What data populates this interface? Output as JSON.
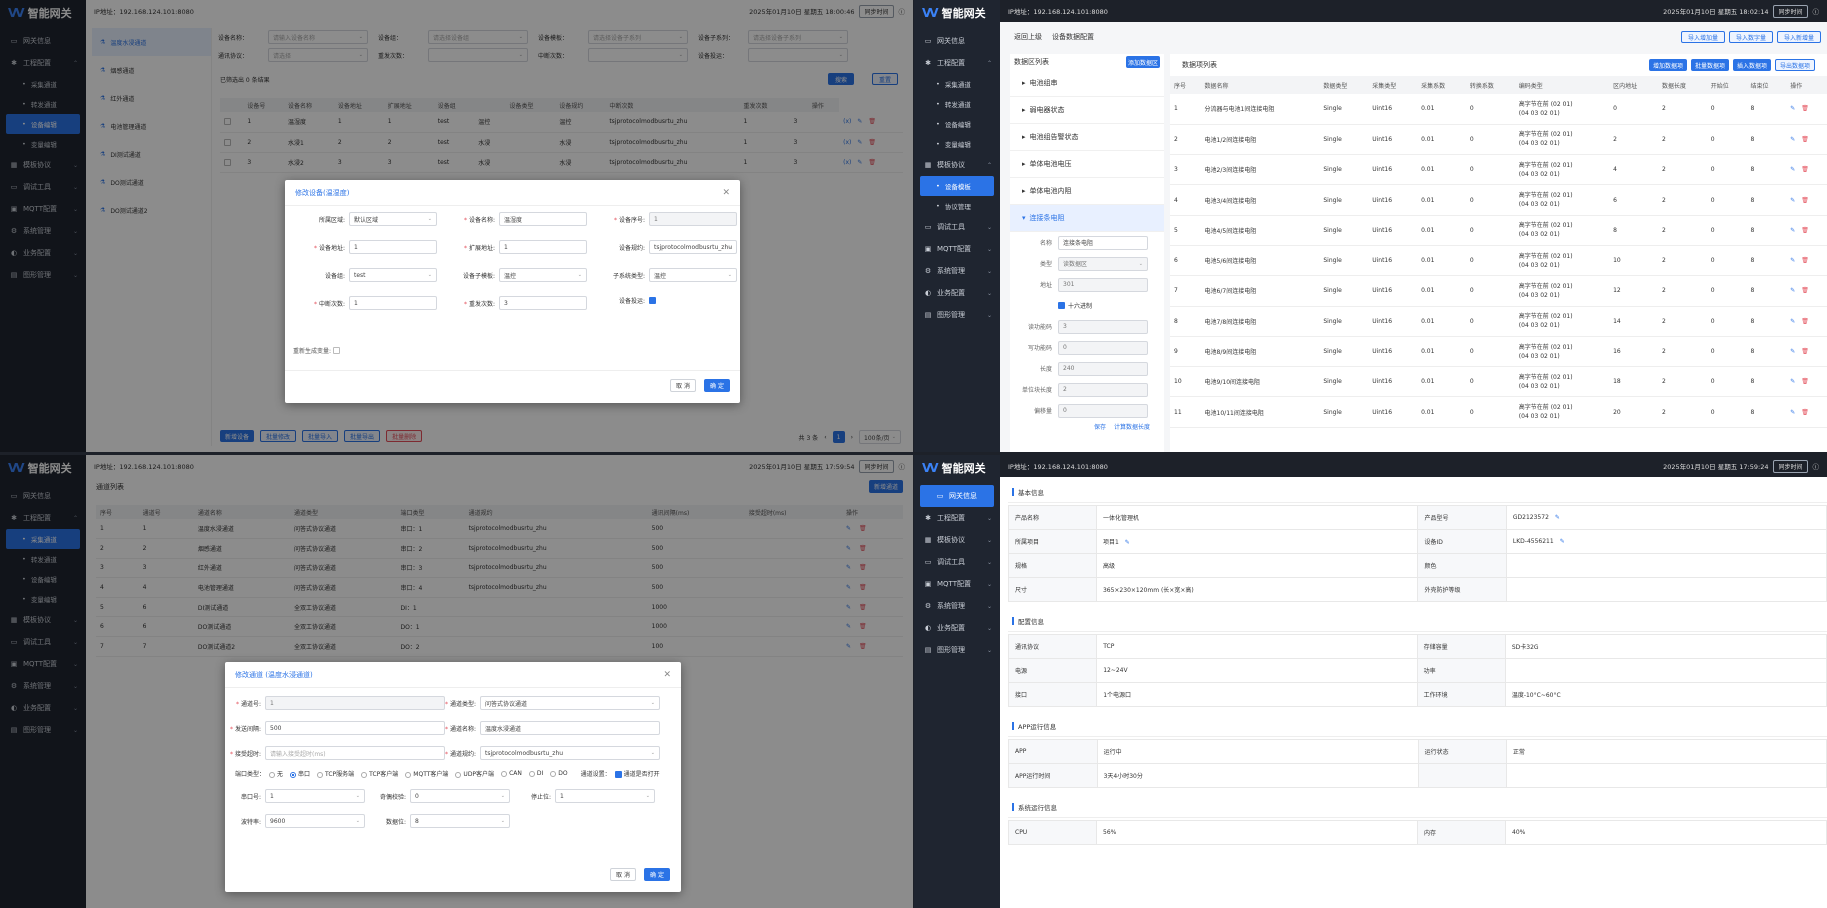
{
  "app": {
    "logo": "智能网关",
    "ip_label": "IP地址：192.168.124.101:8080"
  },
  "icons": {
    "logo": "ww-logo",
    "info": "info-circle-icon",
    "edit": "pencil-icon",
    "delete": "trash-icon",
    "chevron": "chevron-icon"
  },
  "colors": {
    "accent": "#2b73e6",
    "danger": "#e34d59",
    "sidebar": "#1f2530"
  },
  "q1": {
    "datetime": "2025年01月10日 星期五 18:00:46",
    "sync": "同步时间",
    "sidebar": [
      "网关信息",
      "工程配置",
      "采集通道",
      "转发通道",
      "设备编辑",
      "变量编辑",
      "模板协议",
      "调试工具",
      "MQTT配置",
      "系统管理",
      "业务配置",
      "图形管理"
    ],
    "channels": [
      "温度水浸通道",
      "烟感通道",
      "红外通道",
      "电池管理通道",
      "DI测试通道",
      "DO测试通道",
      "DO测试通道2"
    ],
    "filters": [
      "设备名称：",
      "设备组：",
      "设备模板：",
      "设备子系列：",
      "通讯协议：",
      "重发次数：",
      "中断次数：",
      "设备投运："
    ],
    "filter_placeholders": [
      "请输入设备名称",
      "请选择设备组",
      "请选择设备子系列",
      "请选择设备子系列",
      "请选择",
      "",
      "",
      ""
    ],
    "selected": "已筛选出 0 条结果",
    "search": "搜索",
    "reset": "重置",
    "cols": [
      "",
      "设备号",
      "设备名称",
      "设备地址",
      "扩展地址",
      "设备组",
      "",
      "设备类型",
      "设备规约",
      "中断次数",
      "重发次数",
      "",
      "操作"
    ],
    "rows": [
      [
        "1",
        "温湿度",
        "1",
        "1",
        "test",
        "温控",
        "温控",
        "tsjprotocolmodbusrtu_zhu",
        "1",
        "3"
      ],
      [
        "2",
        "水浸1",
        "2",
        "2",
        "test",
        "水浸",
        "水浸",
        "tsjprotocolmodbusrtu_zhu",
        "1",
        "3"
      ],
      [
        "3",
        "水浸2",
        "3",
        "3",
        "test",
        "水浸",
        "水浸",
        "tsjprotocolmodbusrtu_zhu",
        "1",
        "3"
      ]
    ],
    "bottom": [
      "新增设备",
      "批量修改",
      "批量导入",
      "批量导出",
      "批量删除"
    ],
    "pager": {
      "total": "共 3 条",
      "page": "1",
      "size": "100条/页"
    },
    "dialog": {
      "title": "修改设备(温湿度)",
      "fields": [
        {
          "label": "所属区域:",
          "value": "默认区域",
          "dd": true
        },
        {
          "label": "设备名称:",
          "value": "温湿度",
          "req": true
        },
        {
          "label": "设备序号:",
          "value": "1",
          "req": true,
          "ro": true
        },
        {
          "label": "设备地址:",
          "value": "1",
          "req": true
        },
        {
          "label": "扩展地址:",
          "value": "1",
          "req": true
        },
        {
          "label": "设备规约:",
          "value": "tsjprotocolmodbusrtu_zhu",
          "dd": true
        },
        {
          "label": "设备组:",
          "value": "test",
          "dd": true
        },
        {
          "label": "设备子模板:",
          "value": "温控",
          "dd": true
        },
        {
          "label": "子系统类型:",
          "value": "温控",
          "dd": true
        },
        {
          "label": "中断次数:",
          "value": "1",
          "req": true
        },
        {
          "label": "重发次数:",
          "value": "3",
          "req": true
        },
        {
          "label": "设备投运:",
          "value": ""
        }
      ],
      "regen": "重新生成变量:",
      "cancel": "取 消",
      "ok": "确 定"
    }
  },
  "q2": {
    "datetime": "2025年01月10日 星期五 18:02:14",
    "sync": "同步时间",
    "sidebar": [
      "网关信息",
      "工程配置",
      "采集通道",
      "转发通道",
      "设备编辑",
      "变量编辑",
      "模板协议",
      "设备模板",
      "协议管理",
      "调试工具",
      "MQTT配置",
      "系统管理",
      "业务配置",
      "图形管理"
    ],
    "back": "返回上级",
    "crumb": "设备数据配置",
    "top_buttons": [
      "导入增加量",
      "导入数字量",
      "导入新增量"
    ],
    "left_title": "数据区列表",
    "add_area": "添加数据区",
    "areas": [
      "电池组串",
      "弱电器状态",
      "电池组告警状态",
      "单体电池电压",
      "单体电池内阻",
      "连接条电阻"
    ],
    "form": [
      {
        "l": "名称",
        "v": "连接条电阻"
      },
      {
        "l": "类型",
        "v": "读数据区"
      },
      {
        "l": "地址",
        "v": "301"
      },
      {
        "l": "",
        "v": "十六进制"
      },
      {
        "l": "读功能码",
        "v": "3"
      },
      {
        "l": "写功能码",
        "v": "0"
      },
      {
        "l": "长度",
        "v": "240"
      },
      {
        "l": "单位块长度",
        "v": "2"
      },
      {
        "l": "偏移量",
        "v": "0"
      }
    ],
    "save": "保存",
    "calc": "计算数据长度",
    "right_title": "数据项列表",
    "right_buttons": [
      "增加数据项",
      "批量数据项",
      "插入数据项",
      "导出数据项"
    ],
    "cols": [
      "序号",
      "数据名称",
      "数据类型",
      "采集类型",
      "采集系数",
      "转换系数",
      "编码类型",
      "区内地址",
      "数据长度",
      "开始位",
      "结束位",
      "操作"
    ],
    "rows": [
      [
        "1",
        "分流器与电池1间连接电阻",
        "Single",
        "Uint16",
        "0.01",
        "0",
        "0",
        "2",
        "0",
        "8"
      ],
      [
        "2",
        "电池1/2间连接电阻",
        "Single",
        "Uint16",
        "0.01",
        "0",
        "2",
        "2",
        "0",
        "8"
      ],
      [
        "3",
        "电池2/3间连接电阻",
        "Single",
        "Uint16",
        "0.01",
        "0",
        "4",
        "2",
        "0",
        "8"
      ],
      [
        "4",
        "电池3/4间连接电阻",
        "Single",
        "Uint16",
        "0.01",
        "0",
        "6",
        "2",
        "0",
        "8"
      ],
      [
        "5",
        "电池4/5间连接电阻",
        "Single",
        "Uint16",
        "0.01",
        "0",
        "8",
        "2",
        "0",
        "8"
      ],
      [
        "6",
        "电池5/6间连接电阻",
        "Single",
        "Uint16",
        "0.01",
        "0",
        "10",
        "2",
        "0",
        "8"
      ],
      [
        "7",
        "电池6/7间连接电阻",
        "Single",
        "Uint16",
        "0.01",
        "0",
        "12",
        "2",
        "0",
        "8"
      ],
      [
        "8",
        "电池7/8间连接电阻",
        "Single",
        "Uint16",
        "0.01",
        "0",
        "14",
        "2",
        "0",
        "8"
      ],
      [
        "9",
        "电池8/9间连接电阻",
        "Single",
        "Uint16",
        "0.01",
        "0",
        "16",
        "2",
        "0",
        "8"
      ],
      [
        "10",
        "电池9/10间连接电阻",
        "Single",
        "Uint16",
        "0.01",
        "0",
        "18",
        "2",
        "0",
        "8"
      ],
      [
        "11",
        "电池10/11间连接电阻",
        "Single",
        "Uint16",
        "0.01",
        "0",
        "20",
        "2",
        "0",
        "8"
      ]
    ],
    "enc": [
      "高字节在前 (02 01)",
      "(04 03 02 01)"
    ]
  },
  "q3": {
    "datetime": "2025年01月10日 星期五 17:59:54",
    "sync": "同步时间",
    "sidebar": [
      "网关信息",
      "工程配置",
      "采集通道",
      "转发通道",
      "设备编辑",
      "变量编辑",
      "模板协议",
      "调试工具",
      "MQTT配置",
      "系统管理",
      "业务配置",
      "图形管理"
    ],
    "title": "通道列表",
    "new": "新增通道",
    "cols": [
      "序号",
      "通道号",
      "通道名称",
      "通道类型",
      "端口类型",
      "通道规约",
      "通讯间隔(ms)",
      "接受超时(ms)",
      "操作"
    ],
    "rows": [
      [
        "1",
        "1",
        "温度水浸通道",
        "问答式协议通道",
        "串口：1",
        "tsjprotocolmodbusrtu_zhu",
        "500",
        ""
      ],
      [
        "2",
        "2",
        "烟感通道",
        "问答式协议通道",
        "串口：2",
        "tsjprotocolmodbusrtu_zhu",
        "500",
        ""
      ],
      [
        "3",
        "3",
        "红外通道",
        "问答式协议通道",
        "串口：3",
        "tsjprotocolmodbusrtu_zhu",
        "500",
        ""
      ],
      [
        "4",
        "4",
        "电池管理通道",
        "问答式协议通道",
        "串口：4",
        "tsjprotocolmodbusrtu_zhu",
        "500",
        ""
      ],
      [
        "5",
        "6",
        "DI测试通道",
        "全双工协议通道",
        "DI：1",
        "",
        "1000",
        ""
      ],
      [
        "6",
        "6",
        "DO测试通道",
        "全双工协议通道",
        "DO：1",
        "",
        "1000",
        ""
      ],
      [
        "7",
        "7",
        "DO测试通道2",
        "全双工协议通道",
        "DO：2",
        "",
        "100",
        ""
      ]
    ],
    "dialog": {
      "title": "修改通道 (温度水浸通道)",
      "f1": [
        {
          "l": "通道号:",
          "v": "1",
          "ro": true,
          "req": true
        },
        {
          "l": "通道类型:",
          "v": "问答式协议通道",
          "dd": true,
          "req": true
        }
      ],
      "f2": [
        {
          "l": "发送间隔:",
          "v": "500",
          "req": true
        },
        {
          "l": "通道名称:",
          "v": "温度水浸通道",
          "req": true
        }
      ],
      "f3": [
        {
          "l": "接受超时:",
          "v": "请输入接受超时(ms)",
          "ph": true,
          "req": true
        },
        {
          "l": "通道规约:",
          "v": "tsjprotocolmodbusrtu_zhu",
          "dd": true,
          "req": true
        }
      ],
      "port_label": "端口类型：",
      "ports": [
        "无",
        "串口",
        "TCP服务端",
        "TCP客户端",
        "MQTT客户端",
        "UDP客户端",
        "CAN",
        "DI",
        "DO"
      ],
      "channel_setting": "通道设置：",
      "channel_open": "通道是否打开",
      "f4": [
        {
          "l": "串口号:",
          "v": "1",
          "dd": true
        },
        {
          "l": "奇偶校验:",
          "v": "0",
          "dd": true
        },
        {
          "l": "停止位:",
          "v": "1",
          "dd": true
        }
      ],
      "f5": [
        {
          "l": "波特率:",
          "v": "9600",
          "dd": true
        },
        {
          "l": "数据位:",
          "v": "8",
          "dd": true
        }
      ],
      "cancel": "取 消",
      "ok": "确 定"
    }
  },
  "q4": {
    "datetime": "2025年01月10日 星期五 17:59:24",
    "sync": "同步时间",
    "sidebar": [
      "网关信息",
      "工程配置",
      "模板协议",
      "调试工具",
      "MQTT配置",
      "系统管理",
      "业务配置",
      "图形管理"
    ],
    "sections": [
      {
        "title": "基本信息",
        "rows": [
          [
            "产品名称",
            "一体化管理机",
            "产品型号",
            "GD2123572"
          ],
          [
            "所属项目",
            "项目1",
            "设备ID",
            "LKD-4556211"
          ],
          [
            "规格",
            "高级",
            "颜色",
            ""
          ],
          [
            "尺寸",
            "365×230×120mm (长×宽×高)",
            "外壳防护等级",
            ""
          ]
        ]
      },
      {
        "title": "配置信息",
        "rows": [
          [
            "通讯协议",
            "TCP",
            "存储容量",
            "SD卡32G"
          ],
          [
            "电源",
            "12~24V",
            "功率",
            ""
          ],
          [
            "接口",
            "1个电源口",
            "工作环境",
            "温度-10°C~60°C"
          ]
        ]
      },
      {
        "title": "APP运行信息",
        "rows": [
          [
            "APP",
            "运行中",
            "运行状态",
            "正常"
          ],
          [
            "APP运行时间",
            "3天4小时30分",
            "",
            ""
          ]
        ]
      },
      {
        "title": "系统运行信息",
        "rows": [
          [
            "CPU",
            "56%",
            "内存",
            "40%"
          ]
        ]
      }
    ]
  }
}
